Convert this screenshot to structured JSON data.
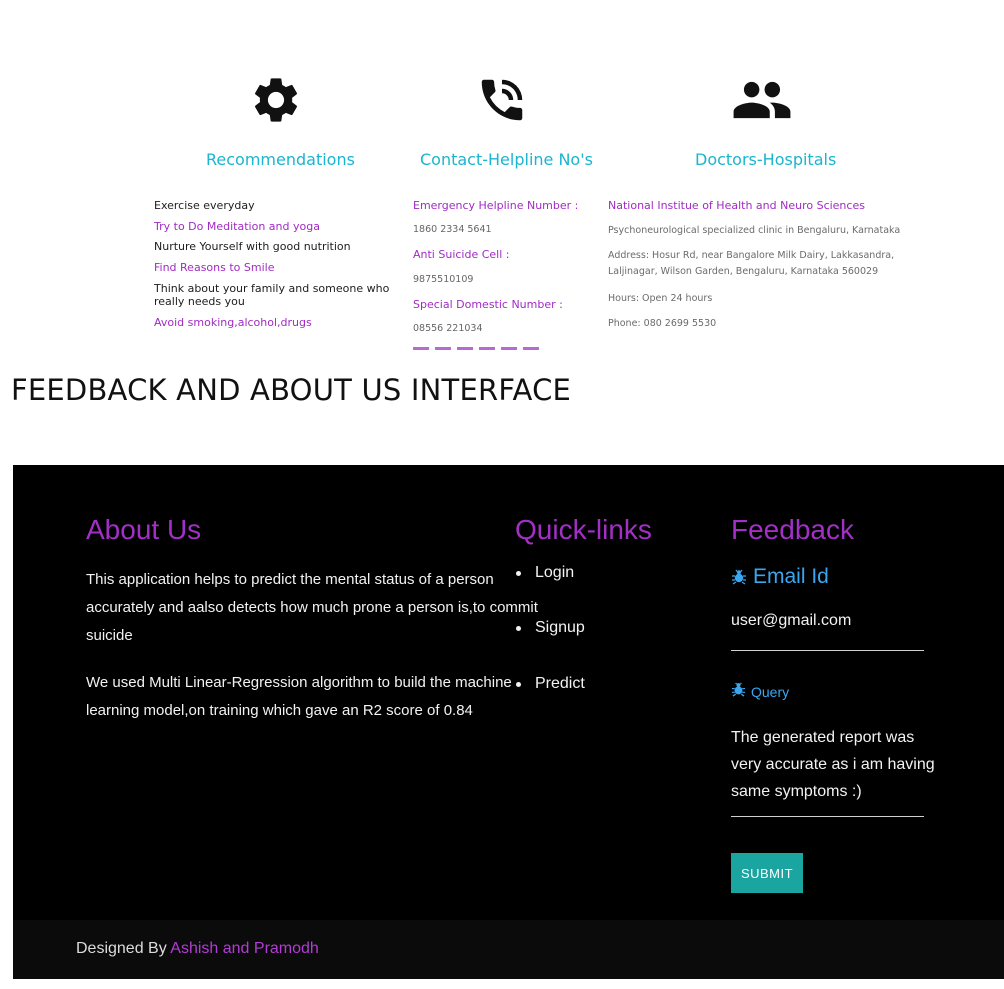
{
  "top": {
    "columns": [
      {
        "icon": "gear-icon",
        "title": "Recommendations"
      },
      {
        "icon": "phone-call-icon",
        "title": "Contact-Helpline No's"
      },
      {
        "icon": "people-icon",
        "title": "Doctors-Hospitals"
      }
    ],
    "recommendations": [
      "Exercise everyday",
      "Try to Do Meditation and yoga",
      "Nurture Yourself with good nutrition",
      "Find Reasons to Smile",
      "Think about your family and someone who",
      "really needs you",
      "Avoid smoking,alcohol,drugs"
    ],
    "helplines": [
      {
        "label": "Emergency Helpline Number :",
        "number": "1860 2334 5641"
      },
      {
        "label": "Anti Suicide Cell :",
        "number": "9875510109"
      },
      {
        "label": "Special Domestic Number :",
        "number": "08556 221034"
      }
    ],
    "hospital": {
      "name": "National Institue of Health and Neuro Sciences",
      "desc": "Psychoneurological specialized clinic in Bengaluru, Karnataka",
      "address1": "Address: Hosur Rd, near Bangalore Milk Dairy, Lakkasandra,",
      "address2": "Laljinagar, Wilson Garden, Bengaluru, Karnataka 560029",
      "hours": "Hours: Open 24 hours",
      "phone": "Phone: 080 2699 5530"
    }
  },
  "section_heading": "FEEDBACK AND ABOUT US INTERFACE",
  "footer": {
    "about": {
      "title": "About Us",
      "para1_lines": [
        "This application helps to predict the mental status of a person",
        "accurately and aalso detects how much prone a person is,to commit",
        "suicide"
      ],
      "para2_lines": [
        "We used Multi Linear-Regression algorithm to build the machine",
        "learning model,on training which gave an R2 score of 0.84"
      ]
    },
    "quick_links": {
      "title": "Quick-links",
      "items": [
        "Login",
        "Signup",
        "Predict"
      ]
    },
    "feedback": {
      "title": "Feedback",
      "email_label": "Email Id",
      "email_value": "user@gmail.com",
      "query_label": "Query",
      "query_lines": [
        "The generated report was",
        "very accurate as i am having",
        "same symptoms :)"
      ],
      "submit_label": "SUBMIT"
    },
    "designed_prefix": "Designed By",
    "designed_names": "Ashish and Pramodh"
  },
  "colors": {
    "teal_title": "#1ab5cf",
    "purple": "#a22fc6",
    "blue_label": "#3aa6f0",
    "submit": "#1aa5a0"
  }
}
